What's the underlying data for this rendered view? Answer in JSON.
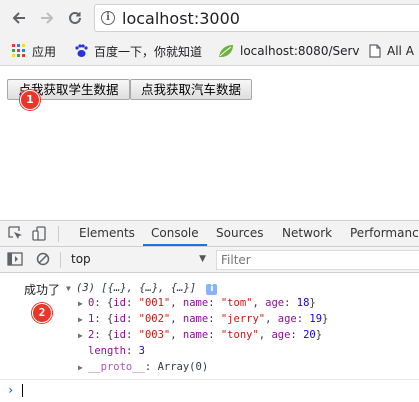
{
  "browser": {
    "url": "localhost:3000"
  },
  "bookmarks": {
    "items": [
      {
        "label": "应用"
      },
      {
        "label": "百度一下，你就知道"
      },
      {
        "label": "localhost:8080/Serv"
      },
      {
        "label": "All A"
      }
    ]
  },
  "page": {
    "buttons": [
      {
        "label": "点我获取学生数据"
      },
      {
        "label": "点我获取汽车数据"
      }
    ],
    "badges": [
      "1",
      "2"
    ]
  },
  "devtools": {
    "tabs": [
      {
        "label": "Elements",
        "active": false
      },
      {
        "label": "Console",
        "active": true
      },
      {
        "label": "Sources",
        "active": false
      },
      {
        "label": "Network",
        "active": false
      },
      {
        "label": "Performance",
        "active": false
      }
    ],
    "context": "top",
    "filter_placeholder": "Filter",
    "console": {
      "log_label": "成功了",
      "array_summary": "(3) [{…}, {…}, {…}]",
      "info_badge": "i",
      "entries": [
        {
          "index": "0",
          "id": "001",
          "name": "tom",
          "age": "18"
        },
        {
          "index": "1",
          "id": "002",
          "name": "jerry",
          "age": "19"
        },
        {
          "index": "2",
          "id": "003",
          "name": "tony",
          "age": "20"
        }
      ],
      "length_key": "length",
      "length_value": "3",
      "proto_key": "__proto__",
      "proto_value": "Array(0)"
    }
  },
  "colors": {
    "accent": "#1a73e8",
    "badge": "#e8362b",
    "key": "#881391",
    "string": "#c41a16",
    "number": "#1c00cf"
  }
}
